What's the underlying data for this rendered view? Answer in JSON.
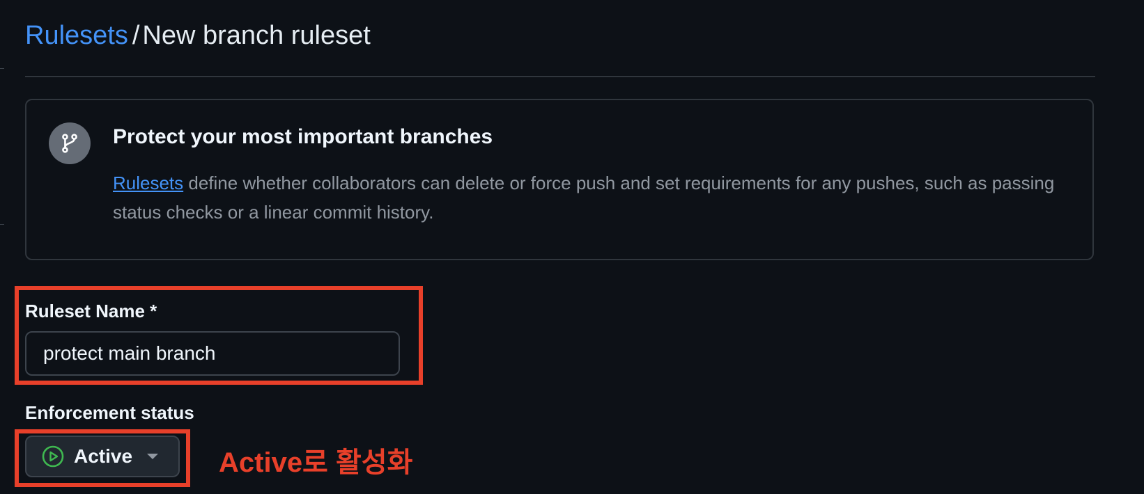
{
  "header": {
    "breadcrumb_link": "Rulesets",
    "separator": "/",
    "current_page": "New branch ruleset"
  },
  "intro": {
    "icon": "git-branch-icon",
    "title": "Protect your most important branches",
    "link_text": "Rulesets",
    "description": " define whether collaborators can delete or force push and set requirements for any pushes, such as passing status checks or a linear commit history."
  },
  "form": {
    "name_label": "Ruleset Name *",
    "name_value": "protect main branch",
    "enforcement_label": "Enforcement status",
    "enforcement_value": "Active",
    "enforcement_icon": "play-circle-icon"
  },
  "annotation": {
    "text": "Active로 활성화",
    "color": "#e8402a"
  },
  "colors": {
    "background": "#0d1117",
    "link": "#4493f8",
    "active_green": "#3fb950"
  }
}
